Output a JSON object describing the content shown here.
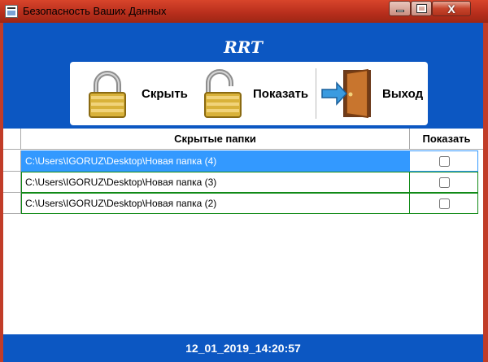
{
  "window": {
    "title": "Безопасность Ваших Данных",
    "close_glyph": "X"
  },
  "header": {
    "brand": "RRT"
  },
  "toolbar": {
    "hide": {
      "label": "Скрыть",
      "icon": "lock-closed-icon"
    },
    "show": {
      "label": "Показать",
      "icon": "lock-open-icon"
    },
    "exit": {
      "label": "Выход",
      "icon": "exit-door-icon"
    }
  },
  "grid": {
    "columns": [
      "Скрытые папки",
      "Показать"
    ],
    "rows": [
      {
        "path": "C:\\Users\\IGORUZ\\Desktop\\Новая папка (4)",
        "show": false,
        "selected": true
      },
      {
        "path": "C:\\Users\\IGORUZ\\Desktop\\Новая папка (3)",
        "show": false,
        "selected": false
      },
      {
        "path": "C:\\Users\\IGORUZ\\Desktop\\Новая папка (2)",
        "show": false,
        "selected": false
      }
    ]
  },
  "footer": {
    "timestamp": "12_01_2019_14:20:57"
  },
  "colors": {
    "header_blue": "#0c57c2",
    "selection_blue": "#3399ff",
    "grid_border_green": "#118a17",
    "titlebar_red": "#c13c28"
  }
}
